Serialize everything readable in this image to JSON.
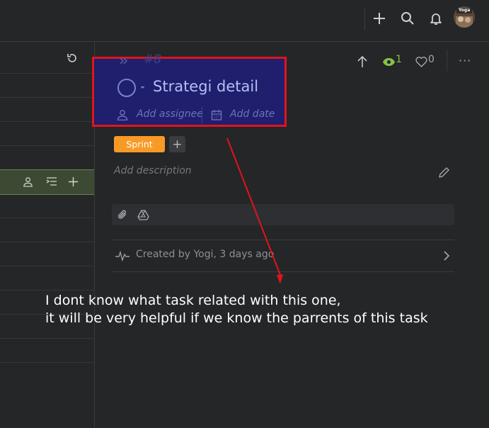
{
  "header": {
    "add_icon": "plus-icon",
    "search_icon": "search-icon",
    "notifications_icon": "bell-icon",
    "avatar_text": "Yoga"
  },
  "task": {
    "number": "#8",
    "title": "Strategi detail",
    "add_assignee": "Add assignee",
    "add_date": "Add date",
    "tag": "Sprint",
    "add_tag": "+",
    "description_placeholder": "Add description",
    "created_by": "Created by Yogi, 3 days ago",
    "watchers": "1",
    "likes": "0",
    "more": "···"
  },
  "annotation": {
    "line1": "I dont know what task related with this one,",
    "line2": "it will be very helpful if we know the parrents of this task"
  },
  "colors": {
    "background": "#252628",
    "highlight_fill": "#1f1f6e",
    "highlight_border": "#e0141c",
    "tag": "#f79b26",
    "watch": "#86c24a",
    "selected_row": "#3c4a33"
  }
}
